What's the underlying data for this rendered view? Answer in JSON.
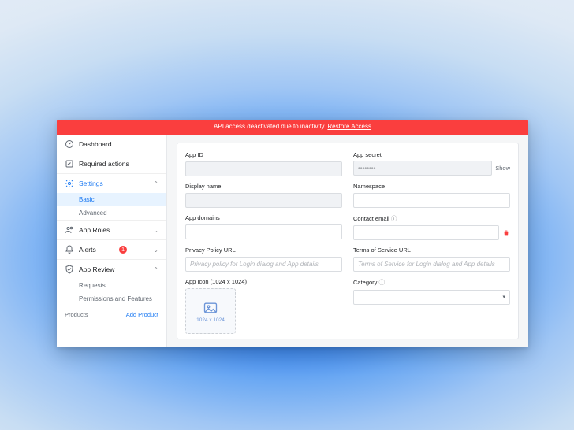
{
  "alert": {
    "message": "API access deactivated due to inactivity.",
    "action": "Restore Access"
  },
  "sidebar": {
    "dashboard": "Dashboard",
    "required_actions": "Required actions",
    "settings": "Settings",
    "settings_basic": "Basic",
    "settings_advanced": "Advanced",
    "app_roles": "App Roles",
    "alerts": "Alerts",
    "alerts_badge": "1",
    "app_review": "App Review",
    "app_review_requests": "Requests",
    "app_review_perms": "Permissions and Features",
    "products_label": "Products",
    "add_product": "Add Product"
  },
  "form": {
    "app_id_label": "App ID",
    "app_id_value": "",
    "app_secret_label": "App secret",
    "app_secret_value": "••••••••",
    "show": "Show",
    "display_name_label": "Display name",
    "display_name_value": "",
    "namespace_label": "Namespace",
    "namespace_value": "",
    "app_domains_label": "App domains",
    "app_domains_value": "",
    "contact_email_label": "Contact email",
    "contact_email_value": "",
    "privacy_label": "Privacy Policy URL",
    "privacy_placeholder": "Privacy policy for Login dialog and App details",
    "tos_label": "Terms of Service URL",
    "tos_placeholder": "Terms of Service for Login dialog and App details",
    "app_icon_label": "App Icon (1024 x 1024)",
    "app_icon_dim": "1024 x 1024",
    "category_label": "Category",
    "category_value": ""
  }
}
